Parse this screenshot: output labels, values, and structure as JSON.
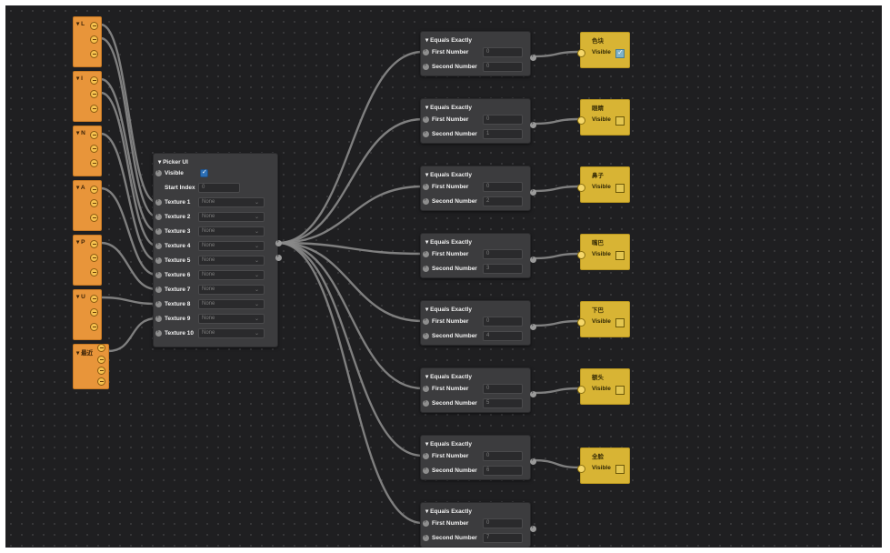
{
  "patch_nodes": [
    {
      "title": "L"
    },
    {
      "title": "I"
    },
    {
      "title": "N"
    },
    {
      "title": "A"
    },
    {
      "title": "P"
    },
    {
      "title": "U"
    },
    {
      "title": "最近"
    }
  ],
  "picker": {
    "title": "Picker UI",
    "visible_label": "Visible",
    "visible_checked": true,
    "start_index_label": "Start Index",
    "start_index_value": "0",
    "textures": [
      {
        "label": "Texture 1",
        "value": "None"
      },
      {
        "label": "Texture 2",
        "value": "None"
      },
      {
        "label": "Texture 3",
        "value": "None"
      },
      {
        "label": "Texture 4",
        "value": "None"
      },
      {
        "label": "Texture 5",
        "value": "None"
      },
      {
        "label": "Texture 6",
        "value": "None"
      },
      {
        "label": "Texture 7",
        "value": "None"
      },
      {
        "label": "Texture 8",
        "value": "None"
      },
      {
        "label": "Texture 9",
        "value": "None"
      },
      {
        "label": "Texture 10",
        "value": "None"
      }
    ]
  },
  "equals_nodes": [
    {
      "title": "Equals Exactly",
      "first_label": "First Number",
      "first_value": "0",
      "second_label": "Second Number",
      "second_value": "0"
    },
    {
      "title": "Equals Exactly",
      "first_label": "First Number",
      "first_value": "0",
      "second_label": "Second Number",
      "second_value": "1"
    },
    {
      "title": "Equals Exactly",
      "first_label": "First Number",
      "first_value": "0",
      "second_label": "Second Number",
      "second_value": "2"
    },
    {
      "title": "Equals Exactly",
      "first_label": "First Number",
      "first_value": "0",
      "second_label": "Second Number",
      "second_value": "3"
    },
    {
      "title": "Equals Exactly",
      "first_label": "First Number",
      "first_value": "0",
      "second_label": "Second Number",
      "second_value": "4"
    },
    {
      "title": "Equals Exactly",
      "first_label": "First Number",
      "first_value": "0",
      "second_label": "Second Number",
      "second_value": "5"
    },
    {
      "title": "Equals Exactly",
      "first_label": "First Number",
      "first_value": "0",
      "second_label": "Second Number",
      "second_value": "6"
    },
    {
      "title": "Equals Exactly",
      "first_label": "First Number",
      "first_value": "0",
      "second_label": "Second Number",
      "second_value": "7"
    }
  ],
  "visible_nodes": [
    {
      "title": "色块",
      "label": "Visible",
      "checked": true
    },
    {
      "title": "眼睛",
      "label": "Visible",
      "checked": false
    },
    {
      "title": "鼻子",
      "label": "Visible",
      "checked": false
    },
    {
      "title": "嘴巴",
      "label": "Visible",
      "checked": false
    },
    {
      "title": "下巴",
      "label": "Visible",
      "checked": false
    },
    {
      "title": "额头",
      "label": "Visible",
      "checked": false
    },
    {
      "title": "全脸",
      "label": "Visible",
      "checked": false
    }
  ],
  "colors": {
    "canvas": "#1f1f21",
    "patch_orange": "#e8953a",
    "node_gray": "#3c3c3e",
    "visible_yellow": "#d8b434",
    "checkbox_blue": "#2c6fb5"
  }
}
